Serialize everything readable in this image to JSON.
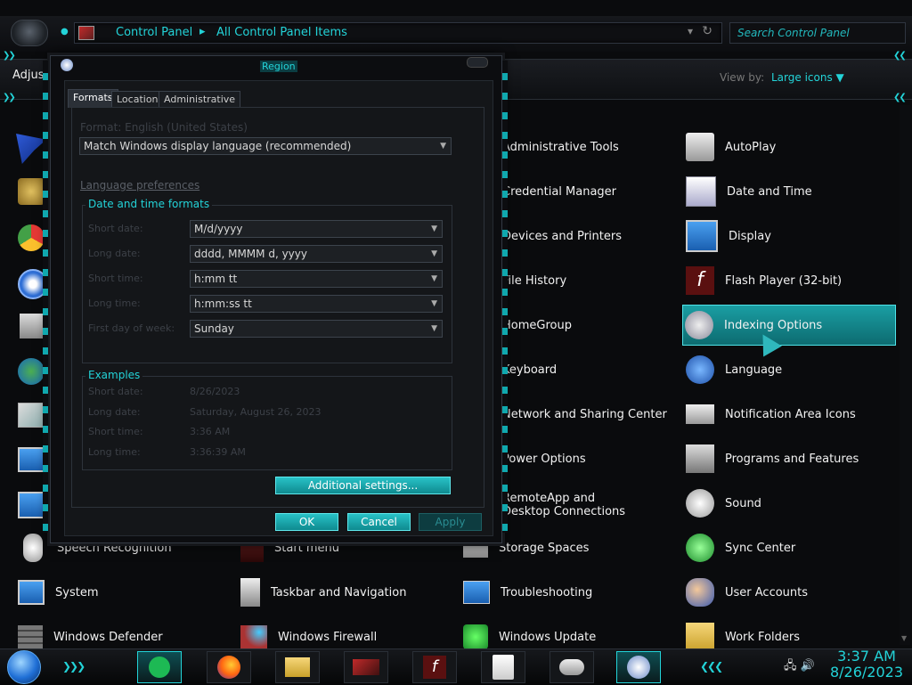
{
  "address_bar": {
    "crumbs": [
      "Control Panel",
      "All Control Panel Items"
    ],
    "separator": "▸",
    "search_placeholder": "Search Control Panel"
  },
  "header": {
    "left_label": "Adjus",
    "view_by_label": "View by:",
    "view_by_value": "Large icons"
  },
  "items": [
    {
      "label": "Administrative Tools",
      "icon": "admin-tools-icon"
    },
    {
      "label": "Credential Manager",
      "icon": "credential-icon"
    },
    {
      "label": "Devices and Printers",
      "icon": "printer-icon"
    },
    {
      "label": "File History",
      "icon": "history-icon"
    },
    {
      "label": "HomeGroup",
      "icon": "homegroup-icon"
    },
    {
      "label": "Keyboard",
      "icon": "keyboard-icon"
    },
    {
      "label": "Network and Sharing Center",
      "icon": "network-icon"
    },
    {
      "label": "Power Options",
      "icon": "power-icon"
    },
    {
      "label": "RemoteApp and Desktop Connections",
      "icon": "remote-icon"
    },
    {
      "label": "Storage Spaces",
      "icon": "storage-icon"
    },
    {
      "label": "Troubleshooting",
      "icon": "troubleshoot-icon"
    },
    {
      "label": "Windows Update",
      "icon": "update-icon"
    },
    {
      "label": "AutoPlay",
      "icon": "autoplay-icon"
    },
    {
      "label": "Date and Time",
      "icon": "calendar-icon"
    },
    {
      "label": "Display",
      "icon": "display-icon"
    },
    {
      "label": "Flash Player (32-bit)",
      "icon": "flash-icon"
    },
    {
      "label": "Indexing Options",
      "icon": "indexing-icon"
    },
    {
      "label": "Language",
      "icon": "language-icon"
    },
    {
      "label": "Notification Area Icons",
      "icon": "notification-icon"
    },
    {
      "label": "Programs and Features",
      "icon": "programs-icon"
    },
    {
      "label": "Sound",
      "icon": "sound-icon"
    },
    {
      "label": "Sync Center",
      "icon": "sync-icon"
    },
    {
      "label": "User Accounts",
      "icon": "users-icon"
    },
    {
      "label": "Work Folders",
      "icon": "folder-icon"
    },
    {
      "label": "Speech Recognition",
      "icon": "microphone-icon"
    },
    {
      "label": "System",
      "icon": "system-icon"
    },
    {
      "label": "Windows Defender",
      "icon": "defender-icon"
    },
    {
      "label": "Start menu",
      "icon": "start-menu-icon"
    },
    {
      "label": "Taskbar and Navigation",
      "icon": "taskbar-icon"
    },
    {
      "label": "Windows Firewall",
      "icon": "firewall-icon"
    }
  ],
  "dialog": {
    "title": "Region",
    "tabs": [
      "Formats",
      "Location",
      "Administrative"
    ],
    "format_label": "Format: English (United States)",
    "format_value": "Match Windows display language (recommended)",
    "language_preferences": "Language preferences",
    "date_time_group": "Date and time formats",
    "fields": [
      {
        "label": "Short date:",
        "value": "M/d/yyyy"
      },
      {
        "label": "Long date:",
        "value": "dddd, MMMM d, yyyy"
      },
      {
        "label": "Short time:",
        "value": "h:mm tt"
      },
      {
        "label": "Long time:",
        "value": "h:mm:ss tt"
      },
      {
        "label": "First day of week:",
        "value": "Sunday"
      }
    ],
    "examples_group": "Examples",
    "examples": [
      {
        "label": "Short date:",
        "value": "8/26/2023"
      },
      {
        "label": "Long date:",
        "value": "Saturday, August 26, 2023"
      },
      {
        "label": "Short time:",
        "value": "3:36 AM"
      },
      {
        "label": "Long time:",
        "value": "3:36:39 AM"
      }
    ],
    "additional_settings": "Additional settings...",
    "ok": "OK",
    "cancel": "Cancel",
    "apply": "Apply"
  },
  "taskbar": {
    "time": "3:37 AM",
    "date": "8/26/2023",
    "apps": [
      "spotify-icon",
      "firefox-icon",
      "file-explorer-icon",
      "control-panel-icon",
      "flash-icon",
      "java-icon",
      "mouse-icon",
      "clock-icon"
    ]
  },
  "colors": {
    "accent": "#23d3d8",
    "selection": "#0d8f94"
  }
}
